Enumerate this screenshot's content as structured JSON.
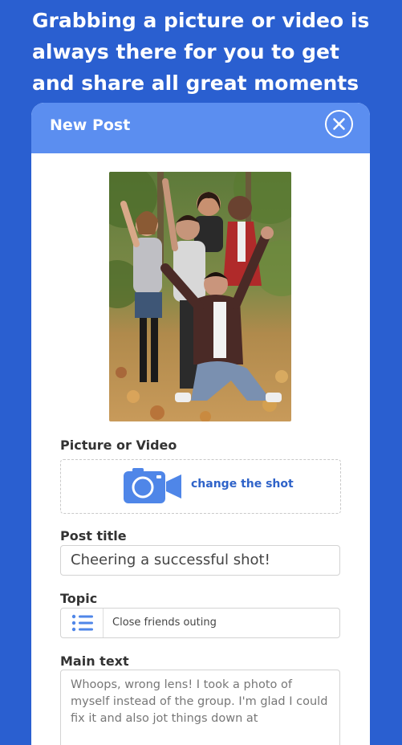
{
  "headline": "Grabbing a picture or video is always there for you to get and share all great moments",
  "dialog": {
    "title": "New Post",
    "close_icon": "close-icon"
  },
  "media": {
    "label": "Picture or Video",
    "change_label": "change the shot",
    "camera_icon": "video-camera-icon"
  },
  "post_title": {
    "label": "Post title",
    "value": "Cheering a successful shot!"
  },
  "topic": {
    "label": "Topic",
    "value": "Close friends outing",
    "icon": "list-icon"
  },
  "main_text": {
    "label": "Main text",
    "value": "Whoops, wrong lens! I took a photo of myself instead of the group. I'm glad I could fix it and also jot things down at"
  },
  "colors": {
    "background": "#2a5fd0",
    "header": "#5b8ef0",
    "accent": "#2f63c9"
  }
}
